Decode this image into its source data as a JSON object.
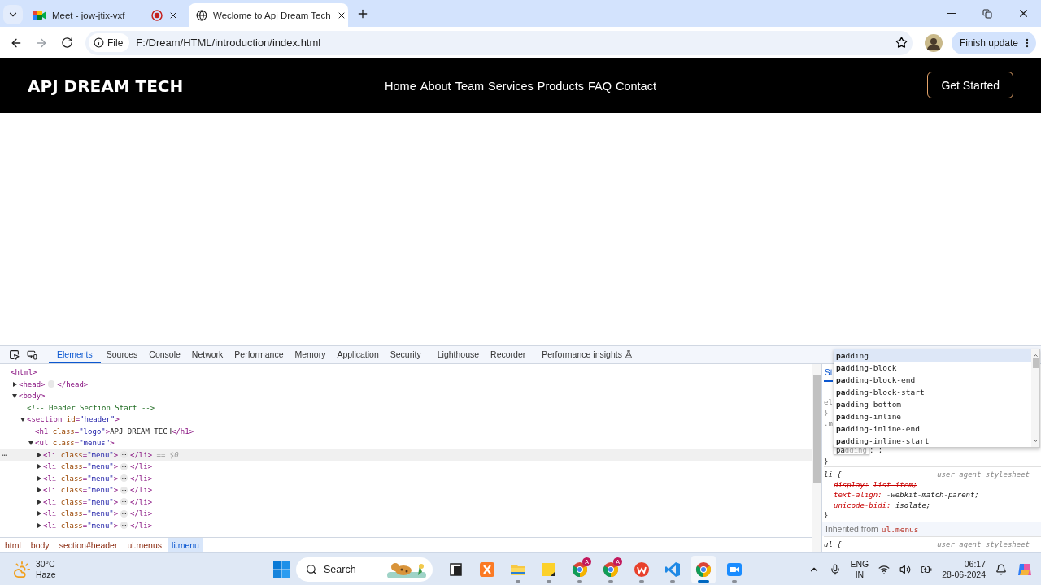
{
  "browser": {
    "tabs": [
      {
        "kind": "meet",
        "title": "Meet - jow-jtix-vxf",
        "selected": false,
        "recording": true
      },
      {
        "kind": "globe",
        "title": "Weclome to Apj Dream Tech",
        "selected": true,
        "recording": false
      }
    ],
    "address": {
      "scheme": "File",
      "url": "F:/Dream/HTML/introduction/index.html"
    },
    "update_button": "Finish update"
  },
  "page": {
    "logo": "APJ DREAM TECH",
    "nav": [
      "Home",
      "About",
      "Team",
      "Services",
      "Products",
      "FAQ",
      "Contact"
    ],
    "cta": "Get Started"
  },
  "devtools": {
    "tabs": [
      {
        "label": "Elements",
        "selected": true
      },
      {
        "label": "Sources",
        "selected": false
      },
      {
        "label": "Console",
        "selected": false
      },
      {
        "label": "Network",
        "selected": false
      },
      {
        "label": "Performance",
        "selected": false
      },
      {
        "label": "Memory",
        "selected": false
      },
      {
        "label": "Application",
        "selected": false
      },
      {
        "label": "Security",
        "selected": false
      },
      {
        "label": "Lighthouse",
        "selected": false
      },
      {
        "label": "Recorder",
        "selected": false
      },
      {
        "label": "Performance insights",
        "selected": false,
        "experimental": true
      }
    ],
    "dom_tree": [
      {
        "tokens": [
          {
            "text": "<html>",
            "kind": "tag"
          }
        ],
        "selected": false,
        "children": [
          {
            "tokens": [
              {
                "text": "<head>",
                "kind": "tag"
              },
              {
                "text": "⋯",
                "kind": "ellipsis"
              },
              {
                "text": "</head>",
                "kind": "tag"
              }
            ],
            "expanded": false,
            "selected": false
          },
          {
            "tokens": [
              {
                "text": "<body>",
                "kind": "tag"
              }
            ],
            "expanded": true,
            "selected": false,
            "children": [
              {
                "tokens": [
                  {
                    "text": "<!-- Header Section Start -->",
                    "kind": "comment"
                  }
                ],
                "selected": false
              },
              {
                "tokens": [
                  {
                    "text": "<section",
                    "kind": "tag"
                  },
                  {
                    "text": " id",
                    "kind": "attr"
                  },
                  {
                    "text": "=",
                    "kind": "tag"
                  },
                  {
                    "text": "\"header\"",
                    "kind": "value"
                  },
                  {
                    "text": ">",
                    "kind": "tag"
                  }
                ],
                "expanded": true,
                "selected": false,
                "children": [
                  {
                    "tokens": [
                      {
                        "text": "<h1",
                        "kind": "tag"
                      },
                      {
                        "text": " class",
                        "kind": "attr"
                      },
                      {
                        "text": "=",
                        "kind": "tag"
                      },
                      {
                        "text": "\"logo\"",
                        "kind": "value"
                      },
                      {
                        "text": ">",
                        "kind": "tag"
                      },
                      {
                        "text": "APJ DREAM TECH",
                        "kind": "text"
                      },
                      {
                        "text": "</h1>",
                        "kind": "tag"
                      }
                    ],
                    "selected": false
                  },
                  {
                    "tokens": [
                      {
                        "text": "<ul",
                        "kind": "tag"
                      },
                      {
                        "text": " class",
                        "kind": "attr"
                      },
                      {
                        "text": "=",
                        "kind": "tag"
                      },
                      {
                        "text": "\"menus\"",
                        "kind": "value"
                      },
                      {
                        "text": ">",
                        "kind": "tag"
                      }
                    ],
                    "expanded": true,
                    "selected": false,
                    "children": [
                      {
                        "gutter": "⋯",
                        "tokens": [
                          {
                            "text": "<li",
                            "kind": "tag"
                          },
                          {
                            "text": " class",
                            "kind": "attr"
                          },
                          {
                            "text": "=",
                            "kind": "tag"
                          },
                          {
                            "text": "\"menu\"",
                            "kind": "value"
                          },
                          {
                            "text": ">",
                            "kind": "tag"
                          },
                          {
                            "text": "⋯",
                            "kind": "ellipsis"
                          },
                          {
                            "text": "</li>",
                            "kind": "tag"
                          },
                          {
                            "text": " == $0",
                            "kind": "hint"
                          }
                        ],
                        "expanded": false,
                        "selected": true
                      },
                      {
                        "tokens": [
                          {
                            "text": "<li",
                            "kind": "tag"
                          },
                          {
                            "text": " class",
                            "kind": "attr"
                          },
                          {
                            "text": "=",
                            "kind": "tag"
                          },
                          {
                            "text": "\"menu\"",
                            "kind": "value"
                          },
                          {
                            "text": ">",
                            "kind": "tag"
                          },
                          {
                            "text": "⋯",
                            "kind": "ellipsis"
                          },
                          {
                            "text": "</li>",
                            "kind": "tag"
                          }
                        ],
                        "expanded": false,
                        "selected": false
                      },
                      {
                        "tokens": [
                          {
                            "text": "<li",
                            "kind": "tag"
                          },
                          {
                            "text": " class",
                            "kind": "attr"
                          },
                          {
                            "text": "=",
                            "kind": "tag"
                          },
                          {
                            "text": "\"menu\"",
                            "kind": "value"
                          },
                          {
                            "text": ">",
                            "kind": "tag"
                          },
                          {
                            "text": "⋯",
                            "kind": "ellipsis"
                          },
                          {
                            "text": "</li>",
                            "kind": "tag"
                          }
                        ],
                        "expanded": false,
                        "selected": false
                      },
                      {
                        "tokens": [
                          {
                            "text": "<li",
                            "kind": "tag"
                          },
                          {
                            "text": " class",
                            "kind": "attr"
                          },
                          {
                            "text": "=",
                            "kind": "tag"
                          },
                          {
                            "text": "\"menu\"",
                            "kind": "value"
                          },
                          {
                            "text": ">",
                            "kind": "tag"
                          },
                          {
                            "text": "⋯",
                            "kind": "ellipsis"
                          },
                          {
                            "text": "</li>",
                            "kind": "tag"
                          }
                        ],
                        "expanded": false,
                        "selected": false
                      },
                      {
                        "tokens": [
                          {
                            "text": "<li",
                            "kind": "tag"
                          },
                          {
                            "text": " class",
                            "kind": "attr"
                          },
                          {
                            "text": "=",
                            "kind": "tag"
                          },
                          {
                            "text": "\"menu\"",
                            "kind": "value"
                          },
                          {
                            "text": ">",
                            "kind": "tag"
                          },
                          {
                            "text": "⋯",
                            "kind": "ellipsis"
                          },
                          {
                            "text": "</li>",
                            "kind": "tag"
                          }
                        ],
                        "expanded": false,
                        "selected": false
                      },
                      {
                        "tokens": [
                          {
                            "text": "<li",
                            "kind": "tag"
                          },
                          {
                            "text": " class",
                            "kind": "attr"
                          },
                          {
                            "text": "=",
                            "kind": "tag"
                          },
                          {
                            "text": "\"menu\"",
                            "kind": "value"
                          },
                          {
                            "text": ">",
                            "kind": "tag"
                          },
                          {
                            "text": "⋯",
                            "kind": "ellipsis"
                          },
                          {
                            "text": "</li>",
                            "kind": "tag"
                          }
                        ],
                        "expanded": false,
                        "selected": false
                      },
                      {
                        "tokens": [
                          {
                            "text": "<li",
                            "kind": "tag"
                          },
                          {
                            "text": " class",
                            "kind": "attr"
                          },
                          {
                            "text": "=",
                            "kind": "tag"
                          },
                          {
                            "text": "\"menu\"",
                            "kind": "value"
                          },
                          {
                            "text": ">",
                            "kind": "tag"
                          },
                          {
                            "text": "⋯",
                            "kind": "ellipsis"
                          },
                          {
                            "text": "</li>",
                            "kind": "tag"
                          }
                        ],
                        "expanded": false,
                        "selected": false
                      }
                    ]
                  }
                ]
              }
            ]
          }
        ]
      }
    ],
    "breadcrumb": [
      {
        "label": "html",
        "selected": false
      },
      {
        "label": "body",
        "selected": false
      },
      {
        "label": "section#header",
        "selected": false
      },
      {
        "label": "ul.menus",
        "selected": false
      },
      {
        "label": "li.menu",
        "selected": true
      }
    ],
    "styles": {
      "tab": "St",
      "fragments": [
        "el",
        "}",
        ".m"
      ],
      "editor": {
        "typed": "pa",
        "suggestion": "dding",
        "rest": ": ;"
      },
      "editor_close": "}",
      "sections": [
        {
          "kind": "rule",
          "selector": "li {",
          "source": "user agent stylesheet",
          "declarations": [
            {
              "prop": "display:",
              "value": "list-item;",
              "overridden": true
            },
            {
              "prop": "text-align:",
              "value": "-webkit-match-parent;",
              "overridden": false
            },
            {
              "prop": "unicode-bidi:",
              "value": "isolate;",
              "overridden": false
            }
          ],
          "close": "}"
        },
        {
          "kind": "inherited",
          "label": "Inherited from",
          "source": "ul.menus"
        },
        {
          "kind": "rule",
          "selector": "ul {",
          "source": "user agent stylesheet"
        }
      ]
    },
    "autocomplete": [
      {
        "label": "**pa**dding",
        "selected": true
      },
      {
        "label": "**pa**dding-block",
        "selected": false
      },
      {
        "label": "**pa**dding-block-end",
        "selected": false
      },
      {
        "label": "**pa**dding-block-start",
        "selected": false
      },
      {
        "label": "**pa**dding-bottom",
        "selected": false
      },
      {
        "label": "**pa**dding-inline",
        "selected": false
      },
      {
        "label": "**pa**dding-inline-end",
        "selected": false
      },
      {
        "label": "**pa**dding-inline-start",
        "selected": false
      }
    ]
  },
  "taskbar": {
    "weather": {
      "temp": "30°C",
      "condition": "Haze"
    },
    "search": "Search",
    "apps": [
      {
        "kind": "taskview",
        "running": false,
        "active": false
      },
      {
        "kind": "xampp",
        "running": false,
        "active": false
      },
      {
        "kind": "folder",
        "running": true,
        "active": false
      },
      {
        "kind": "sticky",
        "running": true,
        "active": false
      },
      {
        "kind": "chrome",
        "badge": "A",
        "running": true,
        "active": false
      },
      {
        "kind": "chrome",
        "badge": "A",
        "running": true,
        "active": false
      },
      {
        "kind": "wps",
        "running": true,
        "active": false
      },
      {
        "kind": "vscode",
        "running": true,
        "active": false
      },
      {
        "kind": "chrome",
        "running": true,
        "active": true
      },
      {
        "kind": "camera",
        "running": true,
        "active": false
      }
    ],
    "tray": {
      "lang": "ENG",
      "region": "IN",
      "time": "06:17",
      "date": "28-06-2024"
    }
  }
}
